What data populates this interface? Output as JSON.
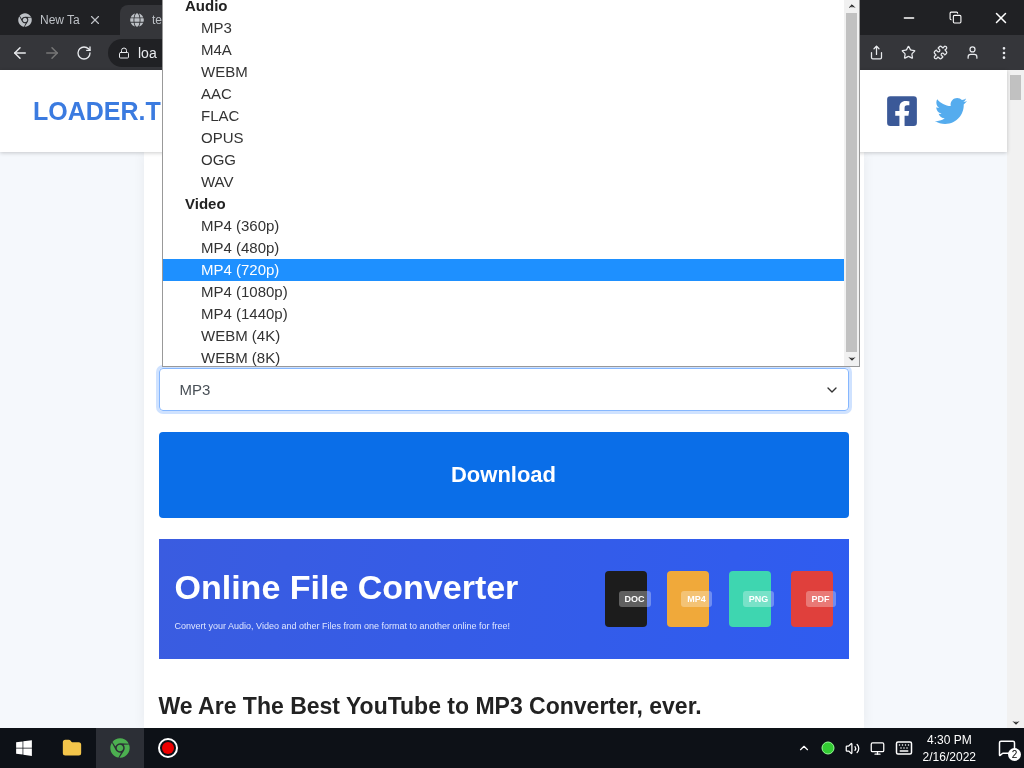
{
  "browser": {
    "tabs": [
      {
        "label": "New Ta",
        "selected": false
      },
      {
        "label": "te",
        "selected": true
      }
    ],
    "address": "loa"
  },
  "site": {
    "logo": "LOADER.T"
  },
  "format_select": {
    "value": "MP3",
    "groups": [
      {
        "label": "Audio",
        "options": [
          {
            "label": "MP3",
            "selected": false
          },
          {
            "label": "M4A",
            "selected": false
          },
          {
            "label": "WEBM",
            "selected": false
          },
          {
            "label": "AAC",
            "selected": false
          },
          {
            "label": "FLAC",
            "selected": false
          },
          {
            "label": "OPUS",
            "selected": false
          },
          {
            "label": "OGG",
            "selected": false
          },
          {
            "label": "WAV",
            "selected": false
          }
        ]
      },
      {
        "label": "Video",
        "options": [
          {
            "label": "MP4 (360p)",
            "selected": false
          },
          {
            "label": "MP4 (480p)",
            "selected": false
          },
          {
            "label": "MP4 (720p)",
            "selected": true
          },
          {
            "label": "MP4 (1080p)",
            "selected": false
          },
          {
            "label": "MP4 (1440p)",
            "selected": false
          },
          {
            "label": "WEBM (4K)",
            "selected": false
          },
          {
            "label": "WEBM (8K)",
            "selected": false
          }
        ]
      }
    ]
  },
  "download_button": "Download",
  "banner": {
    "title": "Online File Converter",
    "subtitle": "Convert your Audio, Video and other Files from one format to another online for free!",
    "files": [
      {
        "label": "DOC",
        "color": "#1c1c1c"
      },
      {
        "label": "MP4",
        "color": "#f0a93a"
      },
      {
        "label": "PNG",
        "color": "#3ed6b0"
      },
      {
        "label": "PDF",
        "color": "#e0403c"
      }
    ]
  },
  "heading": "We Are The Best YouTube to MP3 Converter, ever.",
  "taskbar": {
    "time": "4:30 PM",
    "date": "2/16/2022",
    "notifications": "2"
  }
}
